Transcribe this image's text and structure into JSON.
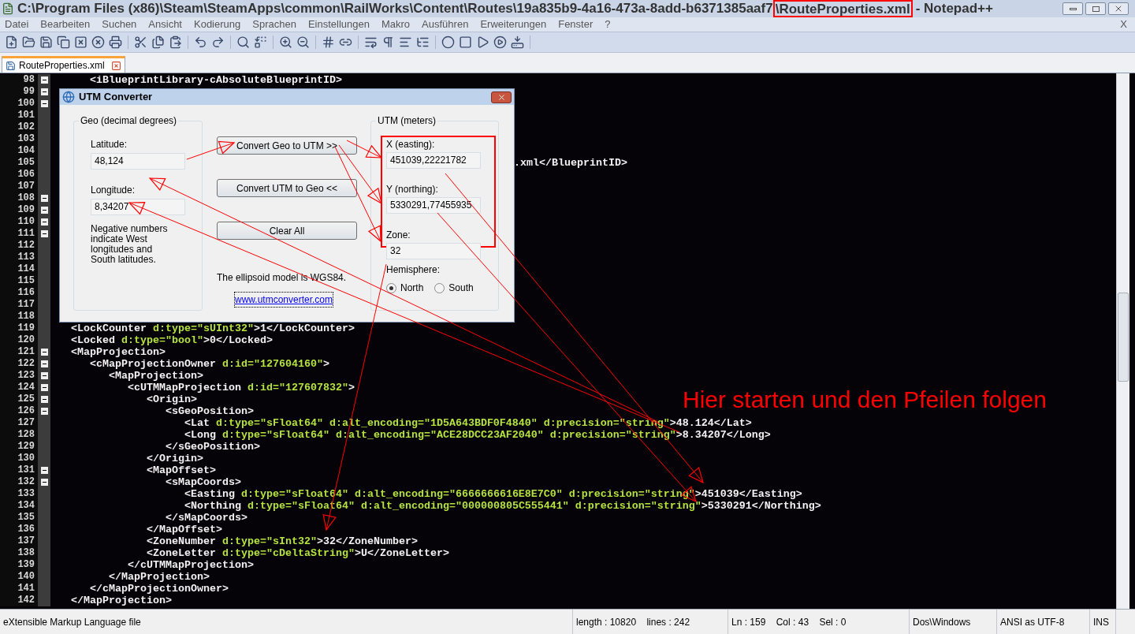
{
  "window": {
    "title_path": "C:\\Program Files (x86)\\Steam\\SteamApps\\common\\RailWorks\\Content\\Routes\\19a835b9-4a16-473a-8add-b6371385aaf7",
    "title_highlighted": "\\RouteProperties.xml",
    "title_suffix": "- Notepad++"
  },
  "menu": [
    "Datei",
    "Bearbeiten",
    "Suchen",
    "Ansicht",
    "Kodierung",
    "Sprachen",
    "Einstellungen",
    "Makro",
    "Ausführen",
    "Erweiterungen",
    "Fenster",
    "?"
  ],
  "menu_close": "X",
  "tabs": [
    {
      "label": "RouteProperties.xml",
      "selected": true
    }
  ],
  "editor": {
    "lines": [
      {
        "number": "98",
        "fold": true,
        "segments": [
          {
            "kind": "tag",
            "text": "      <iBlueprintLibrary-cAbsoluteBlueprintID>"
          }
        ]
      },
      {
        "number": "99",
        "fold": true
      },
      {
        "number": "100",
        "fold": true
      },
      {
        "number": "101",
        "fold": false
      },
      {
        "number": "102",
        "fold": false
      },
      {
        "number": "103",
        "fold": false
      },
      {
        "number": "104",
        "fold": false
      },
      {
        "number": "105",
        "fold": false,
        "clipped_left": true,
        "segments": [
          {
            "kind": "tag",
            "text": ".xml</BlueprintID>"
          }
        ]
      },
      {
        "number": "106",
        "fold": false
      },
      {
        "number": "107",
        "fold": false
      },
      {
        "number": "108",
        "fold": true
      },
      {
        "number": "109",
        "fold": true
      },
      {
        "number": "110",
        "fold": true
      },
      {
        "number": "111",
        "fold": true
      },
      {
        "number": "112",
        "fold": false
      },
      {
        "number": "113",
        "fold": false
      },
      {
        "number": "114",
        "fold": false
      },
      {
        "number": "115",
        "fold": false
      },
      {
        "number": "116",
        "fold": false
      },
      {
        "number": "117",
        "fold": false
      },
      {
        "number": "118",
        "fold": false
      },
      {
        "number": "119",
        "fold": false,
        "segments": [
          {
            "kind": "tag",
            "text": "   <LockCounter "
          },
          {
            "kind": "attr",
            "text": "d:type=\"sUInt32\""
          },
          {
            "kind": "tag",
            "text": ">1</LockCounter>"
          }
        ]
      },
      {
        "number": "120",
        "fold": false,
        "segments": [
          {
            "kind": "tag",
            "text": "   <Locked "
          },
          {
            "kind": "attr",
            "text": "d:type=\"bool\""
          },
          {
            "kind": "tag",
            "text": ">0</Locked>"
          }
        ]
      },
      {
        "number": "121",
        "fold": true,
        "segments": [
          {
            "kind": "tag",
            "text": "   <MapProjection>"
          }
        ]
      },
      {
        "number": "122",
        "fold": true,
        "segments": [
          {
            "kind": "tag",
            "text": "      <cMapProjectionOwner "
          },
          {
            "kind": "attr",
            "text": "d:id=\"127604160\""
          },
          {
            "kind": "tag",
            "text": ">"
          }
        ]
      },
      {
        "number": "123",
        "fold": true,
        "segments": [
          {
            "kind": "tag",
            "text": "         <MapProjection>"
          }
        ]
      },
      {
        "number": "124",
        "fold": true,
        "segments": [
          {
            "kind": "tag",
            "text": "            <cUTMMapProjection "
          },
          {
            "kind": "attr",
            "text": "d:id=\"127607832\""
          },
          {
            "kind": "tag",
            "text": ">"
          }
        ]
      },
      {
        "number": "125",
        "fold": true,
        "segments": [
          {
            "kind": "tag",
            "text": "               <Origin>"
          }
        ]
      },
      {
        "number": "126",
        "fold": true,
        "segments": [
          {
            "kind": "tag",
            "text": "                  <sGeoPosition>"
          }
        ]
      },
      {
        "number": "127",
        "fold": false,
        "segments": [
          {
            "kind": "tag",
            "text": "                     <Lat "
          },
          {
            "kind": "attr",
            "text": "d:type=\"sFloat64\" d:alt_encoding=\"1D5A643BDF0F4840\" d:precision=\"string\""
          },
          {
            "kind": "tag",
            "text": ">48.124</Lat>"
          }
        ]
      },
      {
        "number": "128",
        "fold": false,
        "segments": [
          {
            "kind": "tag",
            "text": "                     <Long "
          },
          {
            "kind": "attr",
            "text": "d:type=\"sFloat64\" d:alt_encoding=\"ACE28DCC23AF2040\" d:precision=\"string\""
          },
          {
            "kind": "tag",
            "text": ">8.34207</Long>"
          }
        ]
      },
      {
        "number": "129",
        "fold": false,
        "segments": [
          {
            "kind": "tag",
            "text": "                  </sGeoPosition>"
          }
        ]
      },
      {
        "number": "130",
        "fold": false,
        "segments": [
          {
            "kind": "tag",
            "text": "               </Origin>"
          }
        ]
      },
      {
        "number": "131",
        "fold": true,
        "segments": [
          {
            "kind": "tag",
            "text": "               <MapOffset>"
          }
        ]
      },
      {
        "number": "132",
        "fold": true,
        "segments": [
          {
            "kind": "tag",
            "text": "                  <sMapCoords>"
          }
        ]
      },
      {
        "number": "133",
        "fold": false,
        "segments": [
          {
            "kind": "tag",
            "text": "                     <Easting "
          },
          {
            "kind": "attr",
            "text": "d:type=\"sFloat64\" d:alt_encoding=\"6666666616E8E7C0\" d:precision=\"string\""
          },
          {
            "kind": "tag",
            "text": ">451039</Easting>"
          }
        ]
      },
      {
        "number": "134",
        "fold": false,
        "segments": [
          {
            "kind": "tag",
            "text": "                     <Northing "
          },
          {
            "kind": "attr",
            "text": "d:type=\"sFloat64\" d:alt_encoding=\"000000805C555441\" d:precision=\"string\""
          },
          {
            "kind": "tag",
            "text": ">5330291</Northing>"
          }
        ]
      },
      {
        "number": "135",
        "fold": false,
        "segments": [
          {
            "kind": "tag",
            "text": "                  </sMapCoords>"
          }
        ]
      },
      {
        "number": "136",
        "fold": false,
        "segments": [
          {
            "kind": "tag",
            "text": "               </MapOffset>"
          }
        ]
      },
      {
        "number": "137",
        "fold": false,
        "segments": [
          {
            "kind": "tag",
            "text": "               <ZoneNumber "
          },
          {
            "kind": "attr",
            "text": "d:type=\"sInt32\""
          },
          {
            "kind": "tag",
            "text": ">32</ZoneNumber>"
          }
        ]
      },
      {
        "number": "138",
        "fold": false,
        "segments": [
          {
            "kind": "tag",
            "text": "               <ZoneLetter "
          },
          {
            "kind": "attr",
            "text": "d:type=\"cDeltaString\""
          },
          {
            "kind": "tag",
            "text": ">U</ZoneLetter>"
          }
        ]
      },
      {
        "number": "139",
        "fold": false,
        "segments": [
          {
            "kind": "tag",
            "text": "            </cUTMMapProjection>"
          }
        ]
      },
      {
        "number": "140",
        "fold": false,
        "segments": [
          {
            "kind": "tag",
            "text": "         </MapProjection>"
          }
        ]
      },
      {
        "number": "141",
        "fold": false,
        "segments": [
          {
            "kind": "tag",
            "text": "      </cMapProjectionOwner>"
          }
        ]
      },
      {
        "number": "142",
        "fold": false,
        "segments": [
          {
            "kind": "tag",
            "text": "   </MapProjection>"
          }
        ]
      }
    ]
  },
  "dialog": {
    "title": "UTM Converter",
    "geo_group": {
      "legend": "Geo (decimal degrees)",
      "latitude_label": "Latitude:",
      "latitude_value": "48,124",
      "longitude_label": "Longitude:",
      "longitude_value": "8,34207",
      "note": "Negative numbers indicate West longitudes and South latitudes."
    },
    "buttons": [
      "Convert Geo to UTM >>",
      "Convert UTM to Geo <<",
      "Clear All"
    ],
    "ellipsoid_note": "The ellipsoid model is WGS84.",
    "link": "www.utmconverter.com",
    "utm_group": {
      "legend": "UTM (meters)",
      "x_label": "X (easting):",
      "x_value": "451039,22221782",
      "y_label": "Y (northing):",
      "y_value": "5330291,77455935",
      "zone_label": "Zone:",
      "zone_value": "32",
      "hemisphere_label": "Hemisphere:",
      "hemispheres": [
        {
          "label": "North",
          "selected": true
        },
        {
          "label": "South",
          "selected": false
        }
      ]
    }
  },
  "annotation": "Hier starten und den Pfeilen folgen",
  "status_bar": [
    "eXtensible Markup Language file",
    "length : 10820    lines : 242",
    "Ln : 159    Col : 43    Sel : 0",
    "Dos\\Windows",
    "ANSI as UTF-8",
    "INS"
  ]
}
